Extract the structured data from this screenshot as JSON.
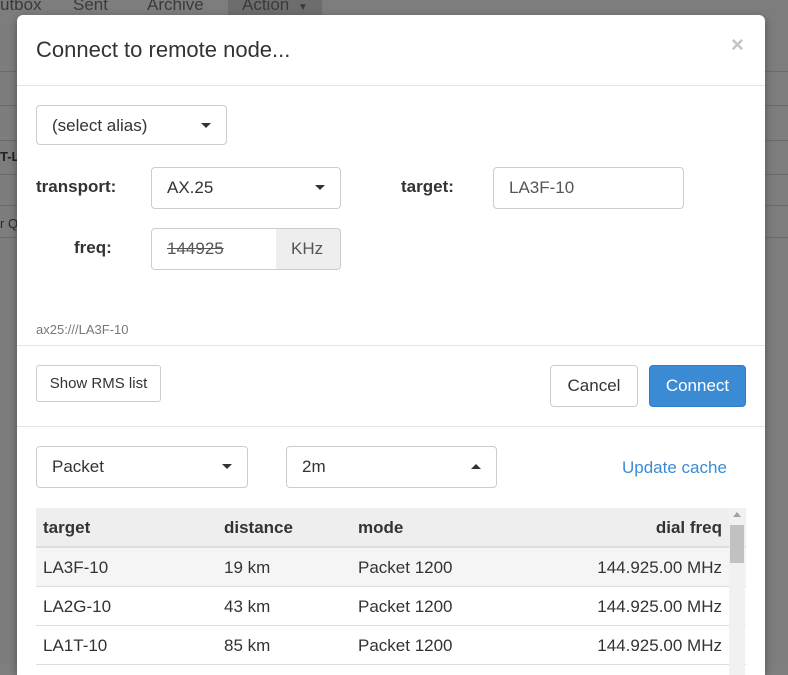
{
  "background": {
    "tabs": [
      "utbox",
      "Sent",
      "Archive",
      "Action"
    ],
    "fragment1": "T-L",
    "fragment2": "r Q"
  },
  "modal": {
    "title": "Connect to remote node...",
    "close": "×"
  },
  "form": {
    "alias_select": "(select alias)",
    "transport_label": "transport:",
    "transport_value": "AX.25",
    "target_label": "target:",
    "target_value": "LA3F-10",
    "freq_label": "freq:",
    "freq_value": "144925",
    "freq_unit": "KHz",
    "url_hint": "ax25:///LA3F-10"
  },
  "actions": {
    "show_rms": "Show RMS list",
    "cancel": "Cancel",
    "connect": "Connect"
  },
  "rms": {
    "mode_select": "Packet",
    "band_select": "2m",
    "update_cache": "Update cache",
    "columns": [
      "target",
      "distance",
      "mode",
      "dial freq"
    ],
    "rows": [
      [
        "LA3F-10",
        "19 km",
        "Packet 1200",
        "144.925.00 MHz"
      ],
      [
        "LA2G-10",
        "43 km",
        "Packet 1200",
        "144.925.00 MHz"
      ],
      [
        "LA1T-10",
        "85 km",
        "Packet 1200",
        "144.925.00 MHz"
      ]
    ]
  },
  "colors": {
    "primary": "#3b8bd4",
    "backdrop": "#7d7d7d"
  }
}
